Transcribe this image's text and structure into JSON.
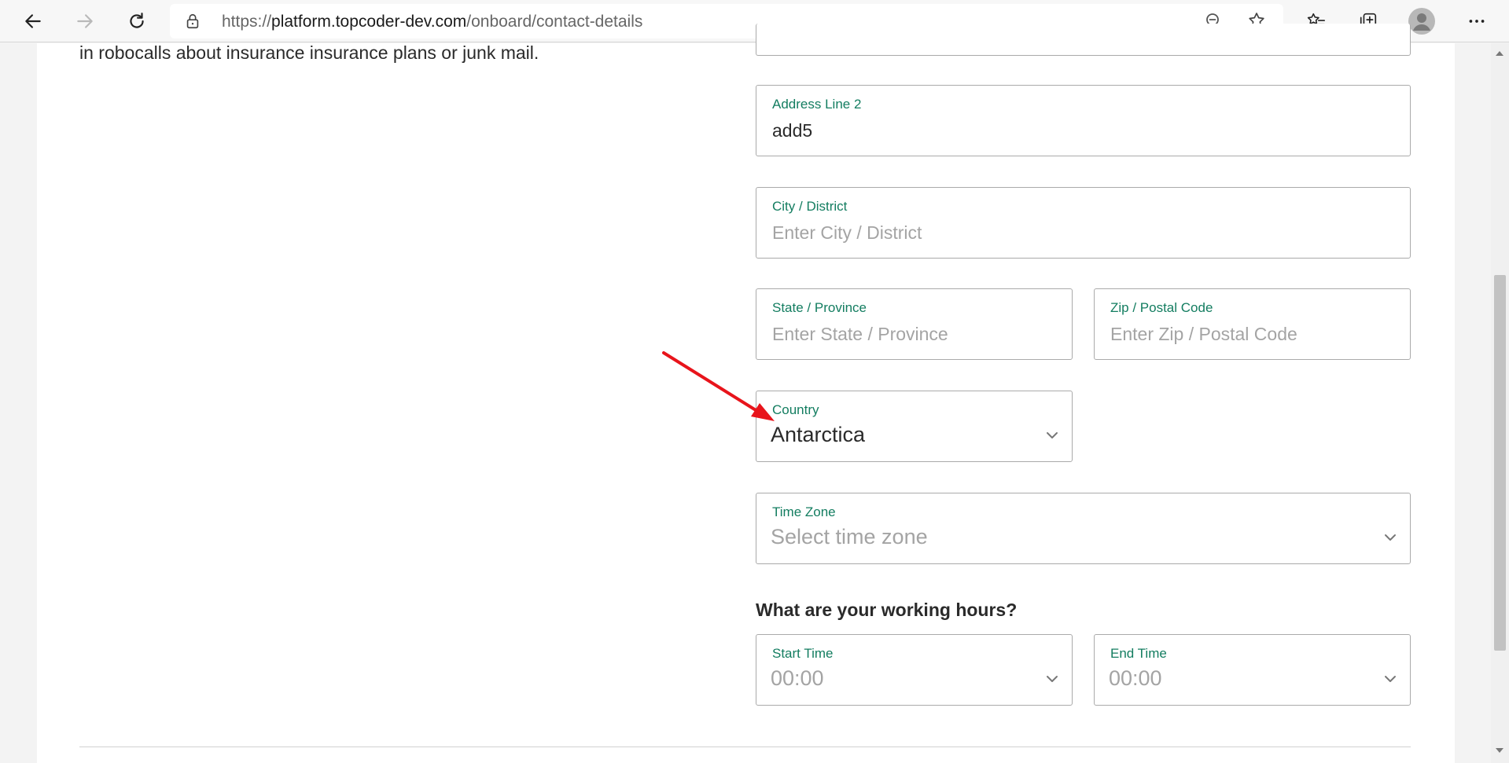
{
  "browser": {
    "url_scheme": "https://",
    "url_host": "platform.topcoder-dev.com",
    "url_path": "/onboard/contact-details"
  },
  "page": {
    "intro_text": "in robocalls about insurance insurance plans or junk mail.",
    "address_line_2": {
      "label": "Address Line 2",
      "value": "add5"
    },
    "city": {
      "label": "City / District",
      "placeholder": "Enter City / District"
    },
    "state": {
      "label": "State / Province",
      "placeholder": "Enter State / Province"
    },
    "zip": {
      "label": "Zip / Postal Code",
      "placeholder": "Enter Zip / Postal Code"
    },
    "country": {
      "label": "Country",
      "value": "Antarctica"
    },
    "time_zone": {
      "label": "Time Zone",
      "placeholder": "Select time zone"
    },
    "working_hours_title": "What are your working hours?",
    "start_time": {
      "label": "Start Time",
      "placeholder": "00:00"
    },
    "end_time": {
      "label": "End Time",
      "placeholder": "00:00"
    }
  },
  "colors": {
    "label_green": "#137d60",
    "annotation_arrow": "#e8141b"
  }
}
